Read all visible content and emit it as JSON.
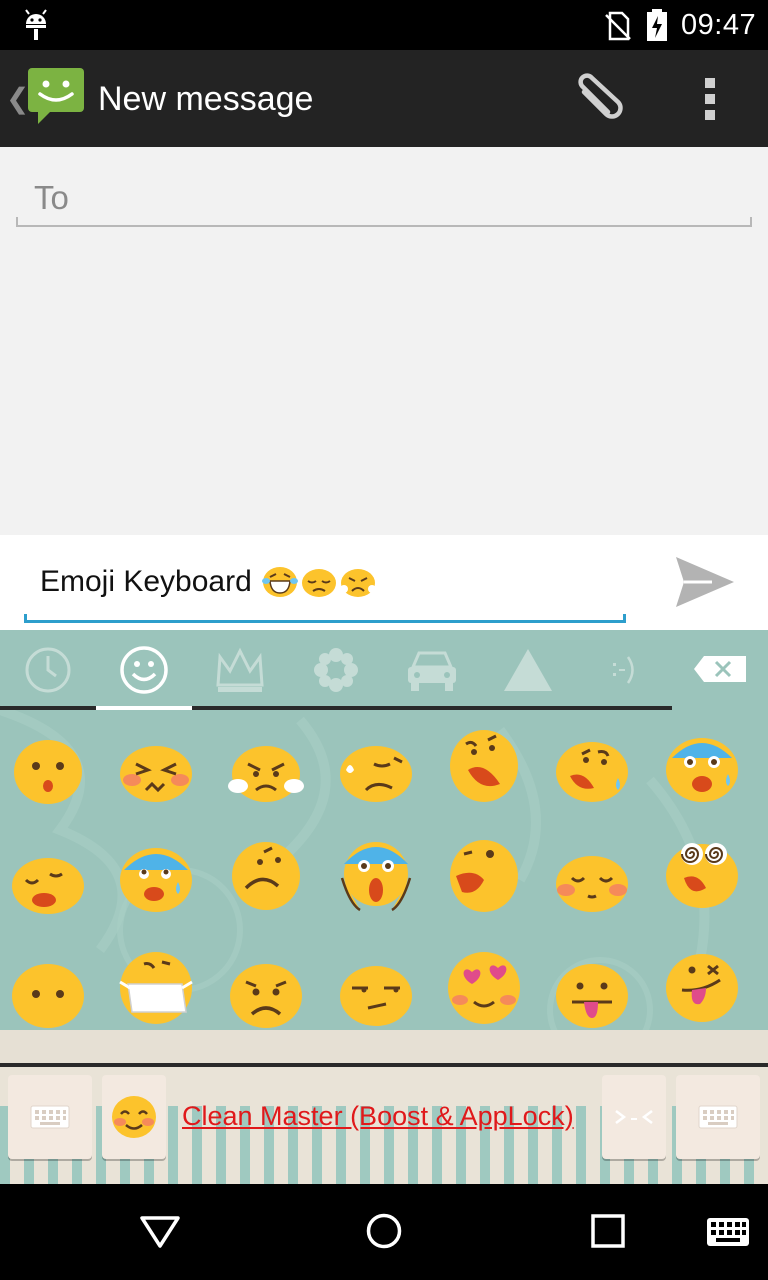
{
  "status_bar": {
    "time": "09:47",
    "icons": [
      "android-debug-icon",
      "no-sim-icon",
      "battery-charging-icon"
    ]
  },
  "action_bar": {
    "title": "New message",
    "icons": [
      "back-caret-icon",
      "messaging-app-icon",
      "attach-paperclip-icon",
      "overflow-menu-icon"
    ]
  },
  "compose": {
    "to_placeholder": "To",
    "message_text": "Emoji Keyboard",
    "message_emojis": [
      "tears-of-joy",
      "pensive",
      "triumph"
    ],
    "send_icon": "send-icon"
  },
  "keyboard": {
    "categories": [
      {
        "name": "recent",
        "icon": "clock-icon"
      },
      {
        "name": "smileys",
        "icon": "smiley-icon",
        "active": true
      },
      {
        "name": "objects",
        "icon": "crown-icon"
      },
      {
        "name": "nature",
        "icon": "flower-icon"
      },
      {
        "name": "places",
        "icon": "car-icon"
      },
      {
        "name": "symbols",
        "icon": "triangle-icon"
      },
      {
        "name": "emoticons",
        "icon": "emoticon-icon"
      }
    ],
    "backspace_icon": "backspace-icon",
    "emoji_rows": [
      [
        "hushed",
        "confounded",
        "angry-steam",
        "disappointed-relieved",
        "weary",
        "tired",
        "fearful"
      ],
      [
        "persevere",
        "cold-sweat",
        "frowning-eyebrow",
        "scream",
        "dizzy-wink",
        "relieved-blush",
        "dizzy-face"
      ],
      [
        "no-mouth",
        "mask",
        "worried",
        "unamused",
        "heart-eyes",
        "tongue",
        "stuck-out-tongue-wink"
      ]
    ],
    "bottom_bar": {
      "left_key_icon": "keyboard-icon",
      "emoji_key_icon": "smiling-blush-icon",
      "ad_text": "Clean Master (Boost & AppLock)",
      "emoticon_key_icon": "emoticon-key-icon",
      "right_key_icon": "keyboard-icon"
    }
  },
  "nav_bar": {
    "icons": [
      "back-icon",
      "home-icon",
      "recents-icon",
      "keyboard-switch-icon"
    ]
  },
  "colors": {
    "action_bar": "#232323",
    "compose_bg": "#f2f2f2",
    "accent": "#2d9ecc",
    "keyboard_bg": "#9bc4bb",
    "emoji_yellow": "#fcc32c",
    "ad_red": "#e0191b"
  }
}
